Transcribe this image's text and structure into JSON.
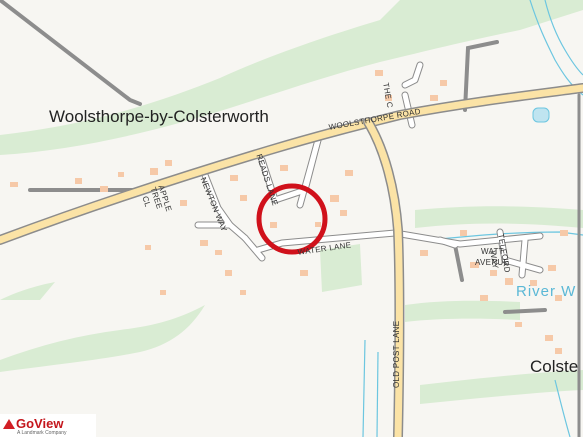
{
  "map": {
    "places": {
      "woolsthorpe": "Woolsthorpe-by-Colsterworth",
      "colsterworth": "Colste"
    },
    "river": "River W",
    "roads": {
      "woolsthorpe_road": "WOOLSTHORPE ROAD",
      "water_lane": "WATER LANE",
      "old_post_lane": "OLD POST LANE",
      "newton_way": "NEWTON WAY",
      "reads_lane": "READS LANE",
      "apple_tree_cl_1": "APPLE",
      "apple_tree_cl_2": "TREE",
      "apple_tree_cl_3": "CL",
      "the_c": "THE C",
      "watt_avenue_1": "WATT",
      "watt_avenue_2": "AVENUE",
      "telford_way_1": "TELFORD",
      "telford_way_2": "WAY"
    },
    "marker": {
      "shape": "circle",
      "color": "#d0111b"
    },
    "colors": {
      "background": "#f7f6f2",
      "green": "#d9ecd3",
      "road_fill": "#fbe3a6",
      "road_casing": "#8c8c8c",
      "minor_road": "#9a9a9a",
      "building": "#f6c9a8",
      "water": "#6cc6e0"
    }
  },
  "logo": {
    "name": "GoView",
    "tagline": "A Landmark Company"
  }
}
